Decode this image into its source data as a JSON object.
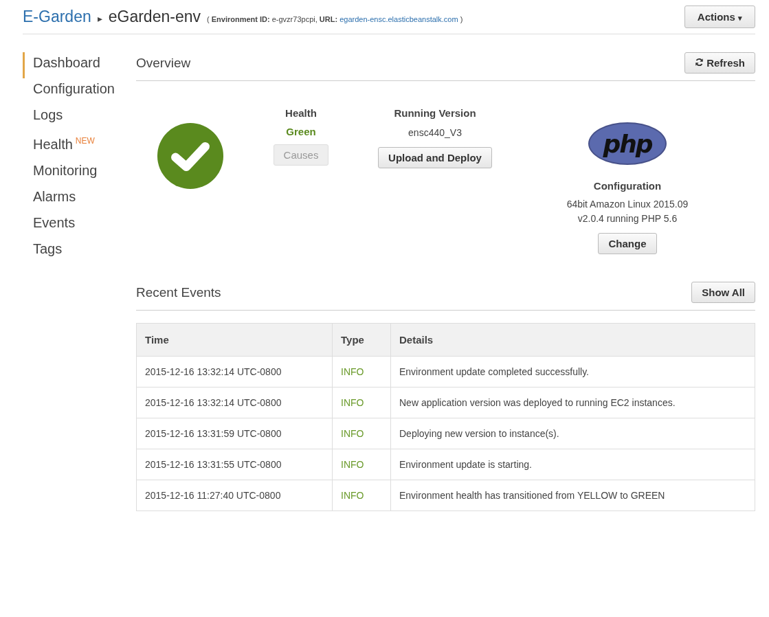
{
  "breadcrumb": {
    "application": "E-Garden",
    "separator": "▸",
    "environment": "eGarden-env",
    "info_prefix": "( **Environment ID:** e-gvzr73pcpi, **URL:** ",
    "url": "egarden-ensc.elasticbeanstalk.com",
    "info_suffix": " )"
  },
  "actions_button": {
    "label": "Actions",
    "caret": "▾"
  },
  "sidebar": {
    "items": [
      {
        "label": "Dashboard",
        "selected": true
      },
      {
        "label": "Configuration",
        "selected": false
      },
      {
        "label": "Logs",
        "selected": false
      },
      {
        "label": "Health",
        "selected": false,
        "badge": "NEW"
      },
      {
        "label": "Monitoring",
        "selected": false
      },
      {
        "label": "Alarms",
        "selected": false
      },
      {
        "label": "Events",
        "selected": false
      },
      {
        "label": "Tags",
        "selected": false
      }
    ]
  },
  "overview": {
    "title": "Overview",
    "refresh_button": "Refresh",
    "health": {
      "heading": "Health",
      "status": "Green",
      "color": "#5a8a1e",
      "causes_button": "Causes",
      "causes_disabled": true
    },
    "running_version": {
      "heading": "Running Version",
      "version": "ensc440_V3",
      "button": "Upload and Deploy"
    },
    "configuration": {
      "logo_text": "php",
      "heading": "Configuration",
      "lines": [
        "64bit Amazon Linux 2015.09",
        "v2.0.4 running PHP 5.6"
      ],
      "button": "Change"
    }
  },
  "recent_events": {
    "title": "Recent Events",
    "show_all_button": "Show All",
    "table": {
      "columns": [
        "Time",
        "Type",
        "Details"
      ],
      "rows": [
        {
          "time": "2015-12-16 13:32:14 UTC-0800",
          "type": "INFO",
          "details": "Environment update completed successfully."
        },
        {
          "time": "2015-12-16 13:32:14 UTC-0800",
          "type": "INFO",
          "details": "New application version was deployed to running EC2 instances."
        },
        {
          "time": "2015-12-16 13:31:59 UTC-0800",
          "type": "INFO",
          "details": "Deploying new version to instance(s)."
        },
        {
          "time": "2015-12-16 13:31:55 UTC-0800",
          "type": "INFO",
          "details": "Environment update is starting."
        },
        {
          "time": "2015-12-16 11:27:40 UTC-0800",
          "type": "INFO",
          "details": "Environment health has transitioned from YELLOW to GREEN"
        }
      ]
    }
  }
}
